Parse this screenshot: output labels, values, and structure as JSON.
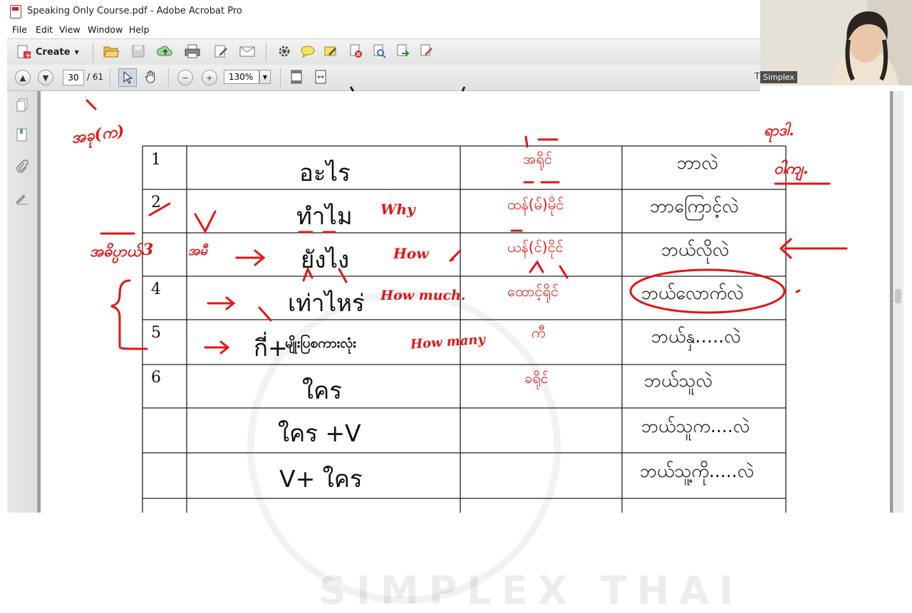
{
  "window": {
    "title": "Speaking Only Course.pdf - Adobe Acrobat Pro"
  },
  "menu": [
    "File",
    "Edit",
    "View",
    "Window",
    "Help"
  ],
  "toolbar": {
    "create_label": "Create",
    "icons": [
      "open-icon",
      "save-icon",
      "upload-icon",
      "print-icon",
      "edit-icon",
      "email-icon",
      "gear-icon",
      "comment-icon",
      "highlight-icon",
      "delete-icon",
      "find-icon",
      "export-icon",
      "sign-icon"
    ]
  },
  "navigation": {
    "current_page": "30",
    "total_pages": "/ 61",
    "zoom": "130%"
  },
  "webcam": {
    "name": "Simplex",
    "cut_text": "T"
  },
  "document": {
    "top_mark": "ၢ",
    "rows": [
      {
        "num": "1",
        "thai": "อะไร",
        "red": "အရိုင်",
        "myanmar": "ဘာလဲ"
      },
      {
        "num": "2",
        "thai": "ทำไม",
        "red": "ထန်(မ်)မိုင်",
        "myanmar": "ဘာကြောင့်လဲ"
      },
      {
        "num": "",
        "thai": "ยังไง",
        "red": "ယန်(င်)ငိုင်",
        "myanmar": "ဘယ်လိုလဲ"
      },
      {
        "num": "4",
        "thai": "เท่าไหร่",
        "red": "ထောင့်ရိုင်",
        "myanmar": "ဘယ်လောက်လဲ"
      },
      {
        "num": "5",
        "thai": "กี่+",
        "thai_suffix": "မျိုးပြစကားလုံး",
        "red": "ကီ",
        "myanmar": "ဘယ်နှ…..လဲ"
      },
      {
        "num": "6",
        "thai": "ใคร",
        "red": "ခရိုင်",
        "myanmar": "ဘယ်သူလဲ"
      },
      {
        "num": "",
        "thai": "ใคร +V",
        "red": "",
        "myanmar": "ဘယ်သူက....လဲ"
      },
      {
        "num": "",
        "thai": "V+ ใคร",
        "red": "",
        "myanmar": "ဘယ်သူ့ကို.....လဲ"
      }
    ],
    "annotations": {
      "left_top": "အခု(က)",
      "left_mid": "အဓိပ္ပာယ်",
      "left_word": "အမီ",
      "v_mark": "V",
      "mark3": "3",
      "why": "Why",
      "how": "How",
      "how_much": "How much.",
      "how_many": "How many",
      "right_top1": "ရာဒါ.",
      "right_top2": "ဝါကျ.",
      "dash": "-"
    }
  }
}
